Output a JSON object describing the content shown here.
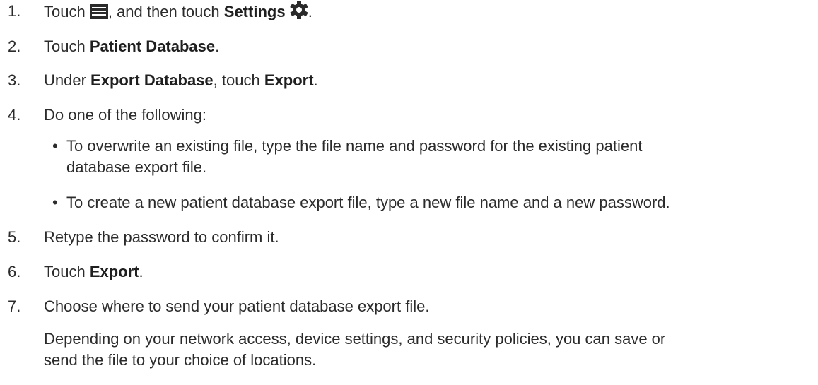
{
  "steps": [
    {
      "num": "1.",
      "pre": "Touch",
      "mid": ", and then touch",
      "bold": "Settings",
      "post": "."
    },
    {
      "num": "2.",
      "pre": "Touch",
      "bold": "Patient Database",
      "post": "."
    },
    {
      "num": "3.",
      "pre": "Under",
      "bold": "Export Database",
      "mid": ", touch",
      "bold2": "Export",
      "post": "."
    },
    {
      "num": "4.",
      "text": "Do one of the following:"
    },
    {
      "num": "5.",
      "text": "Retype the password to confirm it."
    },
    {
      "num": "6.",
      "pre": "Touch",
      "bold": "Export",
      "post": "."
    },
    {
      "num": "7.",
      "text": "Choose where to send your patient database export file."
    }
  ],
  "bullets": [
    {
      "marker": "•",
      "line1": "To overwrite an existing file, type the file name and password for the existing patient",
      "line2": "database export file."
    },
    {
      "marker": "•",
      "line1": "To create a new patient database export file, type a new file name and a new password."
    }
  ],
  "note": {
    "line1": "Depending on your network access, device settings, and security policies, you can save or",
    "line2": "send the file to your choice of locations."
  },
  "icons": {
    "menu": "menu-icon",
    "settings": "gear-icon"
  }
}
